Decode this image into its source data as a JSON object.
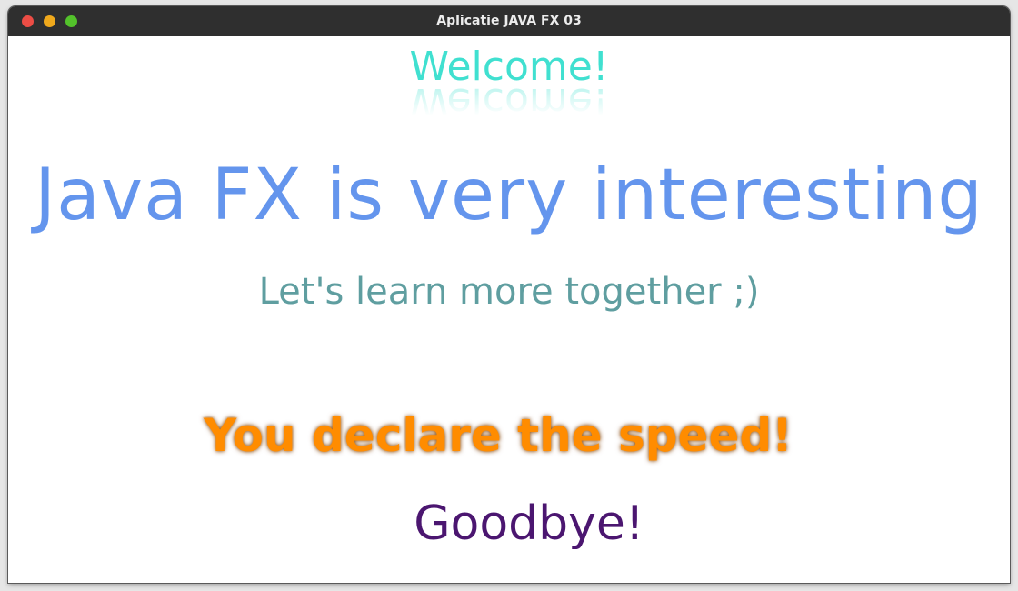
{
  "window": {
    "title": "Aplicatie JAVA FX 03"
  },
  "content": {
    "welcome": "Welcome!",
    "headline": "Java FX is very interesting",
    "subline": "Let's learn more together ;)",
    "speed": "You declare the speed!",
    "goodbye": "Goodbye!"
  },
  "colors": {
    "welcome": "#40e0d0",
    "headline": "#6495ed",
    "subline": "#5f9ea0",
    "speed": "#ff8c00",
    "goodbye": "#4b1670",
    "titlebar": "#2f2f2f"
  },
  "icons": {
    "close": "close-icon",
    "minimize": "minimize-icon",
    "maximize": "maximize-icon"
  }
}
